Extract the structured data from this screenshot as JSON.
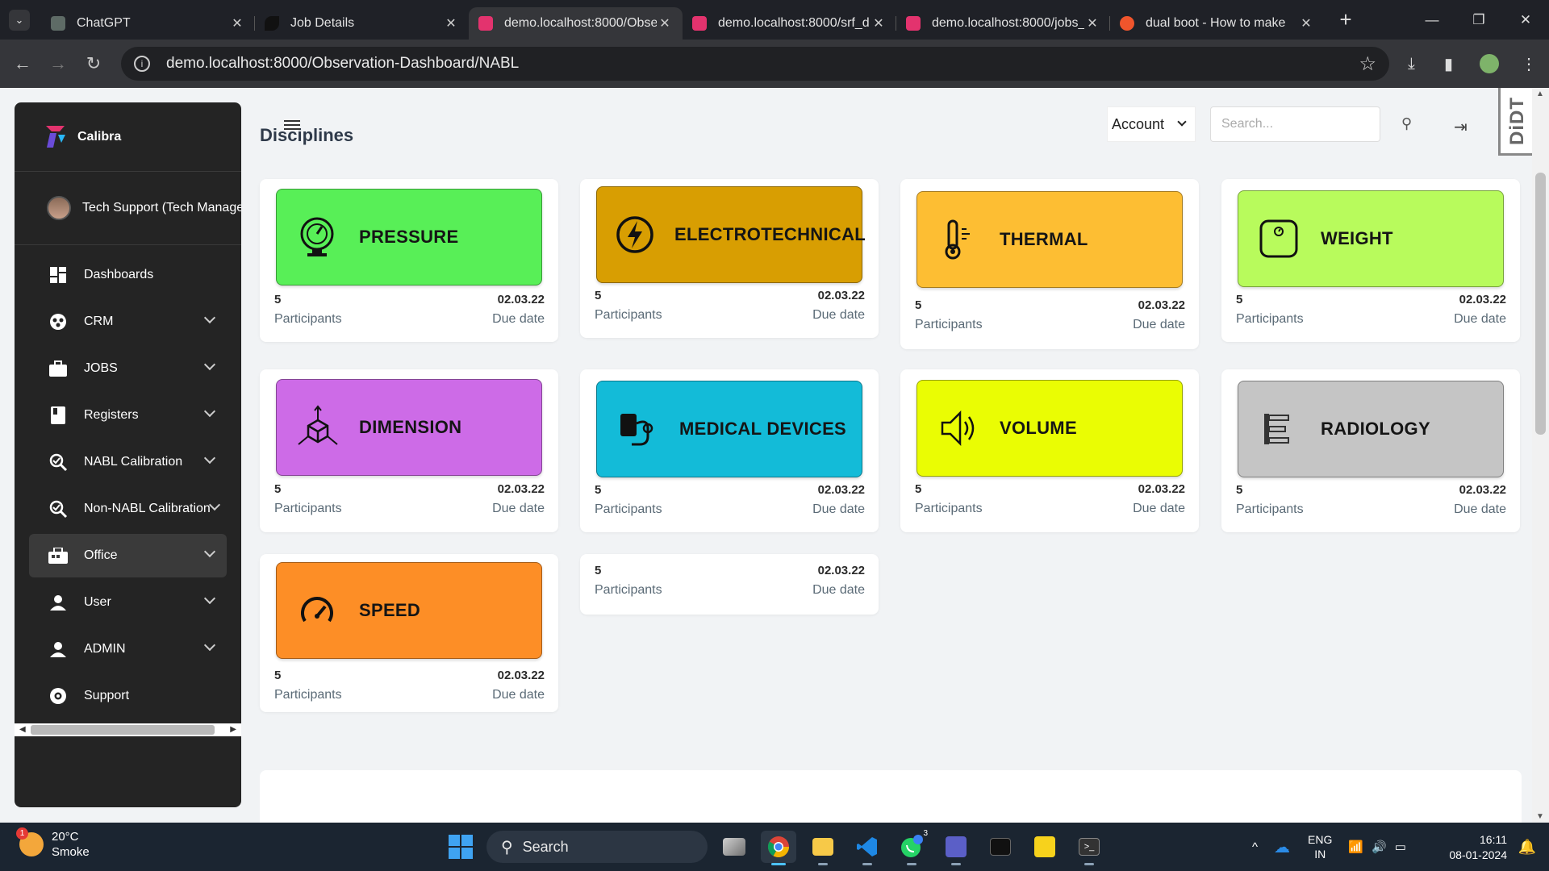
{
  "browser": {
    "tabs": [
      {
        "title": "ChatGPT",
        "icon": "chatgpt-icon",
        "color": "#5e6b66"
      },
      {
        "title": "Job Details",
        "icon": "bowtie-icon",
        "color": "#222222"
      },
      {
        "title": "demo.localhost:8000/Obse",
        "icon": "calibra-icon",
        "color": "#e3336e"
      },
      {
        "title": "demo.localhost:8000/srf_d",
        "icon": "calibra-icon",
        "color": "#e3336e"
      },
      {
        "title": "demo.localhost:8000/jobs_",
        "icon": "calibra-icon",
        "color": "#e3336e"
      },
      {
        "title": "dual boot - How to make",
        "icon": "ask-icon",
        "color": "#f0552c"
      }
    ],
    "url": "demo.localhost:8000/Observation-Dashboard/NABL"
  },
  "sidebar": {
    "brand": "Calibra",
    "user": "Tech Support (Tech Manager)",
    "items": [
      {
        "label": "Dashboards",
        "icon": "dashboard-icon",
        "chevron": false
      },
      {
        "label": "CRM",
        "icon": "crm-icon",
        "chevron": true
      },
      {
        "label": "JOBS",
        "icon": "briefcase-icon",
        "chevron": true
      },
      {
        "label": "Registers",
        "icon": "register-icon",
        "chevron": true
      },
      {
        "label": "NABL Calibration",
        "icon": "calibration-icon",
        "chevron": true
      },
      {
        "label": "Non-NABL Calibration",
        "icon": "calibration-icon",
        "chevron": true
      },
      {
        "label": "Office",
        "icon": "office-icon",
        "chevron": true,
        "active": true
      },
      {
        "label": "User",
        "icon": "user-icon",
        "chevron": true
      },
      {
        "label": "ADMIN",
        "icon": "admin-icon",
        "chevron": true
      },
      {
        "label": "Support",
        "icon": "support-icon",
        "chevron": false
      }
    ]
  },
  "header": {
    "title": "Disciplines",
    "account_label": "Account",
    "search_placeholder": "Search...",
    "badge": "DiDT"
  },
  "cards": [
    {
      "name": "PRESSURE",
      "color": "#58ef57",
      "icon": "pressure-gauge-icon",
      "participants": "5",
      "participants_label": "Participants",
      "date": "02.03.22",
      "date_label": "Due date"
    },
    {
      "name": "ELECTROTECHNICAL",
      "color": "#d89e02",
      "icon": "lightning-icon",
      "participants": "5",
      "participants_label": "Participants",
      "date": "02.03.22",
      "date_label": "Due date"
    },
    {
      "name": "THERMAL",
      "color": "#fdbe33",
      "icon": "thermometer-icon",
      "participants": "5",
      "participants_label": "Participants",
      "date": "02.03.22",
      "date_label": "Due date"
    },
    {
      "name": "WEIGHT",
      "color": "#b8fb5c",
      "icon": "scale-icon",
      "participants": "5",
      "participants_label": "Participants",
      "date": "02.03.22",
      "date_label": "Due date"
    },
    {
      "name": "DIMENSION",
      "color": "#cd6be7",
      "icon": "cube-icon",
      "participants": "5",
      "participants_label": "Participants",
      "date": "02.03.22",
      "date_label": "Due date"
    },
    {
      "name": "MEDICAL DEVICES",
      "color": "#13bbd8",
      "icon": "stethoscope-icon",
      "participants": "5",
      "participants_label": "Participants",
      "date": "02.03.22",
      "date_label": "Due date"
    },
    {
      "name": "VOLUME",
      "color": "#eafd03",
      "icon": "speaker-icon",
      "participants": "5",
      "participants_label": "Participants",
      "date": "02.03.22",
      "date_label": "Due date"
    },
    {
      "name": "RADIOLOGY",
      "color": "#c5c5c5",
      "icon": "radiology-icon",
      "participants": "5",
      "participants_label": "Participants",
      "date": "02.03.22",
      "date_label": "Due date"
    },
    {
      "name": "SPEED",
      "color": "#fd8e26",
      "icon": "speedometer-icon",
      "participants": "5",
      "participants_label": "Participants",
      "date": "02.03.22",
      "date_label": "Due date"
    },
    {
      "name": "",
      "participants": "5",
      "participants_label": "Participants",
      "date": "02.03.22",
      "date_label": "Due date"
    }
  ],
  "taskbar": {
    "weather_temp": "20°C",
    "weather_desc": "Smoke",
    "weather_badge": "1",
    "search_label": "Search",
    "lang_line1": "ENG",
    "lang_line2": "IN",
    "time": "16:11",
    "date": "08-01-2024",
    "whatsapp_badge": "3"
  }
}
